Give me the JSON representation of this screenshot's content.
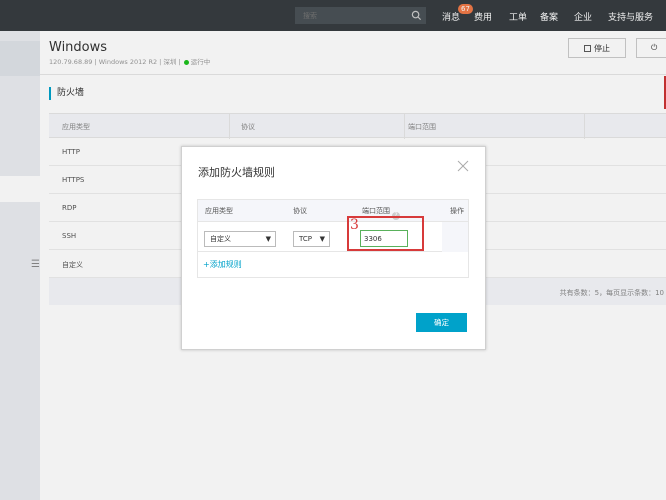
{
  "topbar": {
    "search_placeholder": "搜索",
    "nav": {
      "messages": "消息",
      "message_count": "67",
      "fees": "费用",
      "tickets": "工单",
      "record": "备案",
      "enterprise": "企业",
      "support": "支持与服务"
    }
  },
  "sidebar": {
    "menu_icon": "☰"
  },
  "instance": {
    "title": "Windows",
    "ip": "120.79.68.89",
    "os": "Windows 2012 R2",
    "region": "深圳",
    "status": "运行中",
    "status_color": "#1dc11d",
    "stop_label": "停止",
    "restart_icon": "⏻"
  },
  "section": {
    "title": "防火墙"
  },
  "table": {
    "headers": [
      "应用类型",
      "协议",
      "端口范围"
    ],
    "rows": [
      "HTTP",
      "HTTPS",
      "RDP",
      "SSH",
      "自定义"
    ],
    "footer": "共有条数：5，每页显示条数：10"
  },
  "modal": {
    "title": "添加防火墙规则",
    "headers": {
      "type": "应用类型",
      "protocol": "协议",
      "port": "端口范围",
      "ops": "操作"
    },
    "row": {
      "type": "自定义",
      "protocol": "TCP",
      "port": "3306"
    },
    "add_rule": "+添加规则",
    "confirm": "确定",
    "annotation": "3"
  },
  "colors": {
    "accent": "#00a2ca",
    "annotation": "#d73a3a",
    "topbar": "#373d41"
  }
}
